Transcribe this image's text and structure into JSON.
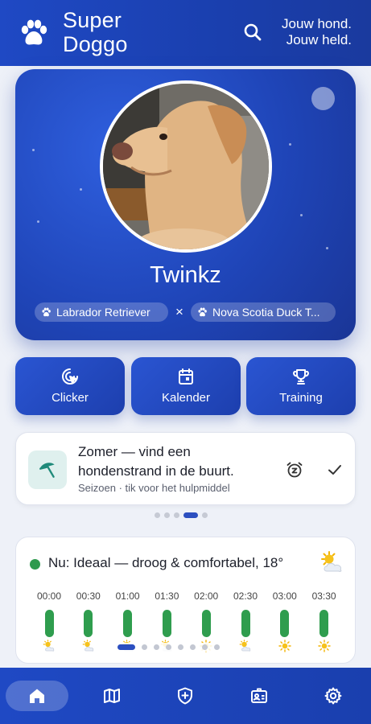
{
  "app": {
    "brand_line1": "Super",
    "brand_line2": "Doggo",
    "tagline_line1": "Jouw hond.",
    "tagline_line2": "Jouw held."
  },
  "profile": {
    "name": "Twinkz",
    "breeds": [
      "Labrador Retriever",
      "Nova Scotia Duck T..."
    ],
    "mix_symbol": "×"
  },
  "actions": [
    {
      "label": "Clicker",
      "icon": "cursor-click-icon"
    },
    {
      "label": "Kalender",
      "icon": "calendar-icon"
    },
    {
      "label": "Training",
      "icon": "trophy-icon"
    }
  ],
  "tip": {
    "title": "Zomer — vind een hondenstrand in de buurt.",
    "subtitle": "Seizoen · tik voor het hulpmiddel",
    "icon": "beach-umbrella-icon",
    "carousel_count": 5,
    "carousel_active": 3
  },
  "weather": {
    "now": "Nu: Ideaal — droog & comfortabel, 18°",
    "status_color": "#2e9a4e",
    "slots": [
      {
        "time": "00:00",
        "icon": "sun-cloud-icon"
      },
      {
        "time": "00:30",
        "icon": "sun-cloud-icon"
      },
      {
        "time": "01:00",
        "icon": "sun-cloud-icon"
      },
      {
        "time": "01:30",
        "icon": "sun-cloud-icon"
      },
      {
        "time": "02:00",
        "icon": "sun-icon"
      },
      {
        "time": "02:30",
        "icon": "sun-cloud-icon"
      },
      {
        "time": "03:00",
        "icon": "sun-icon"
      },
      {
        "time": "03:30",
        "icon": "sun-icon"
      }
    ],
    "pager_count": 8,
    "pager_active": 0
  },
  "nav": [
    {
      "name": "home",
      "icon": "home-icon",
      "active": true
    },
    {
      "name": "map",
      "icon": "map-icon",
      "active": false
    },
    {
      "name": "health",
      "icon": "shield-plus-icon",
      "active": false
    },
    {
      "name": "id-card",
      "icon": "id-card-icon",
      "active": false
    },
    {
      "name": "settings",
      "icon": "gear-icon",
      "active": false
    }
  ],
  "colors": {
    "primary": "#1f49c4",
    "accent": "#2c4fc0",
    "good": "#2f9d4e"
  }
}
